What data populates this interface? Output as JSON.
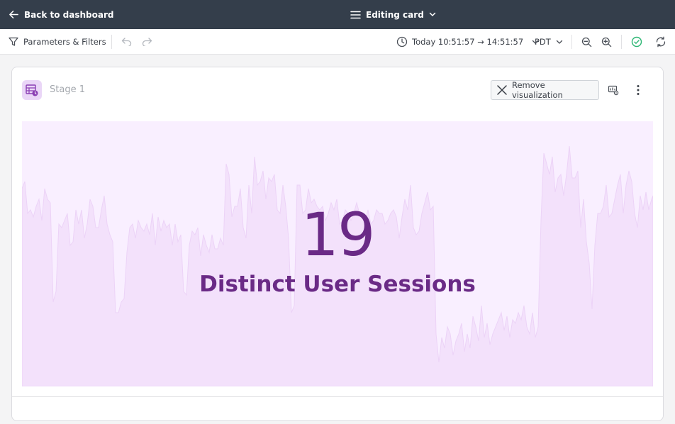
{
  "topbar": {
    "back_label": "Back to dashboard",
    "editing_label": "Editing card"
  },
  "toolbar": {
    "params_label": "Parameters & Filters",
    "time_range": "Today 10:51:57 → 14:51:57",
    "timezone": "PDT"
  },
  "card": {
    "stage_label": "Stage 1",
    "remove_label": "Remove visualization"
  },
  "visualization": {
    "type": "big-number",
    "value": "19",
    "label": "Distinct User Sessions",
    "colors": {
      "text": "#6a2a86",
      "background": "#f9efff",
      "sparkline": "#f3e1fb"
    }
  },
  "icons": {
    "back": "arrow-left-icon",
    "menu": "hamburger-menu-icon",
    "chevron": "chevron-down-icon",
    "filter": "filter-funnel-icon",
    "undo": "undo-icon",
    "redo": "redo-icon",
    "clock": "clock-icon",
    "zoom_out": "zoom-out-icon",
    "zoom_in": "zoom-in-icon",
    "status": "check-circle-icon",
    "refresh": "refresh-icon",
    "stage": "table-clock-icon",
    "close": "close-icon",
    "settings": "viz-settings-icon",
    "more": "more-vertical-icon"
  }
}
